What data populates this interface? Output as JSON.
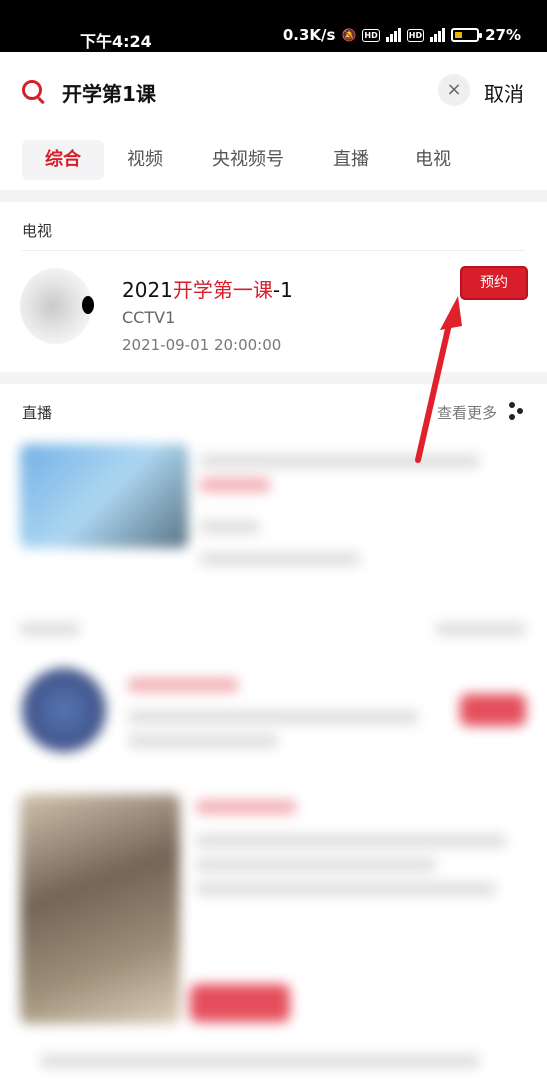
{
  "status_bar": {
    "time": "下午4:24",
    "net_speed": "0.3K/s",
    "hd_badge": "HD",
    "net_type": "4G",
    "battery": "27%"
  },
  "search": {
    "query": "开学第1课",
    "clear_label": "×",
    "cancel_label": "取消"
  },
  "tabs": [
    "综合",
    "视频",
    "央视频号",
    "直播",
    "电视"
  ],
  "tv_section": {
    "title": "电视",
    "item": {
      "title_prefix": "2021",
      "title_highlight": "开学第一课",
      "title_suffix": "-1",
      "channel": "CCTV1",
      "time": "2021-09-01 20:00:00",
      "reserve_label": "预约"
    }
  },
  "live_section": {
    "title": "直播",
    "more_label": "查看更多"
  },
  "colors": {
    "accent": "#d81e2a",
    "status_bar": "#000000",
    "page_bg": "#f3f4f6"
  }
}
